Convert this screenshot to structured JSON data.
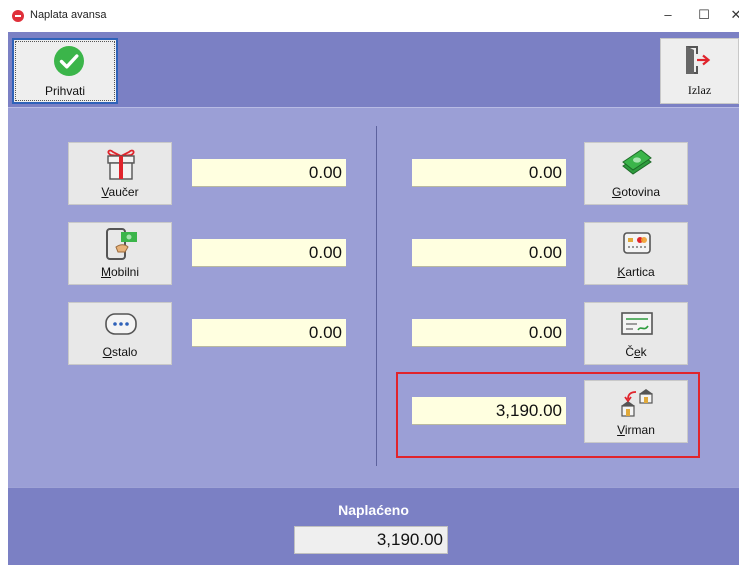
{
  "window": {
    "title": "Naplata avansa",
    "minimize": "–",
    "maximize": "☐",
    "close": "✕"
  },
  "toolbar": {
    "accept_label": "Prihvati",
    "exit_label": "Izlaz"
  },
  "left_methods": [
    {
      "key": "V",
      "rest": "aučer",
      "amount": "0.00",
      "icon": "gift-icon"
    },
    {
      "key": "M",
      "rest": "obilni",
      "amount": "0.00",
      "icon": "mobile-payment-icon"
    },
    {
      "key": "O",
      "rest": "stalo",
      "amount": "0.00",
      "icon": "chat-bubble-icon"
    }
  ],
  "right_methods": [
    {
      "key": "G",
      "rest": "otovina",
      "amount": "0.00",
      "icon": "cash-icon"
    },
    {
      "key": "K",
      "rest": "artica",
      "amount": "0.00",
      "icon": "card-icon"
    },
    {
      "pre": "Č",
      "key": "e",
      "rest": "k",
      "amount": "0.00",
      "icon": "check-icon"
    },
    {
      "key": "V",
      "rest": "irman",
      "amount": "3,190.00",
      "icon": "bank-transfer-icon"
    }
  ],
  "footer": {
    "paid_label": "Naplaćeno",
    "paid_value": "3,190.00"
  },
  "colors": {
    "toolbar_bg": "#7b80c4",
    "panel_bg": "#9b9fd6",
    "amount_bg": "#ffffe0",
    "highlight": "#e0242c",
    "accept_green": "#3bb54a"
  }
}
